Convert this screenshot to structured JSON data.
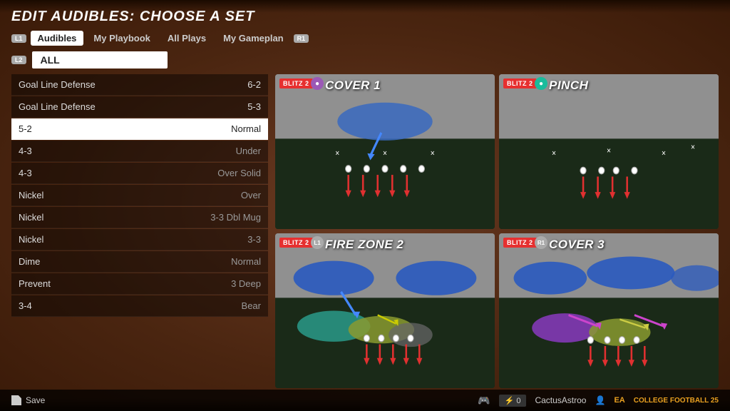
{
  "header": {
    "title": "EDIT AUDIBLES: CHOOSE A SET"
  },
  "tabs": {
    "l1_badge": "L1",
    "r1_badge": "R1",
    "items": [
      {
        "label": "Audibles",
        "active": true
      },
      {
        "label": "My Playbook",
        "active": false
      },
      {
        "label": "All Plays",
        "active": false
      },
      {
        "label": "My Gameplan",
        "active": false
      }
    ]
  },
  "filter": {
    "l2_badge": "L2",
    "value": "ALL"
  },
  "play_list": [
    {
      "formation": "Goal Line Defense",
      "play": "6-2",
      "selected": false
    },
    {
      "formation": "Goal Line Defense",
      "play": "5-3",
      "selected": false
    },
    {
      "formation": "5-2",
      "play": "Normal",
      "selected": true
    },
    {
      "formation": "4-3",
      "play": "Under",
      "selected": false
    },
    {
      "formation": "4-3",
      "play": "Over Solid",
      "selected": false
    },
    {
      "formation": "Nickel",
      "play": "Over",
      "selected": false
    },
    {
      "formation": "Nickel",
      "play": "3-3 Dbl Mug",
      "selected": false
    },
    {
      "formation": "Nickel",
      "play": "3-3",
      "selected": false
    },
    {
      "formation": "Dime",
      "play": "Normal",
      "selected": false
    },
    {
      "formation": "Prevent",
      "play": "3 Deep",
      "selected": false
    },
    {
      "formation": "3-4",
      "play": "Bear",
      "selected": false
    }
  ],
  "play_cards": [
    {
      "id": "card1",
      "badge": "BLITZ 2",
      "icon_type": "purple",
      "icon_label": "●",
      "title": "COVER 1",
      "field_type": "cover1"
    },
    {
      "id": "card2",
      "badge": "BLITZ 2",
      "icon_type": "teal",
      "icon_label": "●",
      "title": "PINCH",
      "field_type": "pinch"
    },
    {
      "id": "card3",
      "badge": "BLITZ 2",
      "icon_type": "l1",
      "icon_label": "L1",
      "title": "FIRE ZONE 2",
      "field_type": "firezone2"
    },
    {
      "id": "card4",
      "badge": "BLITZ 2",
      "icon_type": "r1-icon",
      "icon_label": "R1",
      "title": "COVER 3",
      "field_type": "cover3"
    }
  ],
  "bottom_bar": {
    "save_label": "Save",
    "score": "0",
    "username": "CactusAstroo",
    "brand": "COLLEGE FOOTBALL 25"
  }
}
